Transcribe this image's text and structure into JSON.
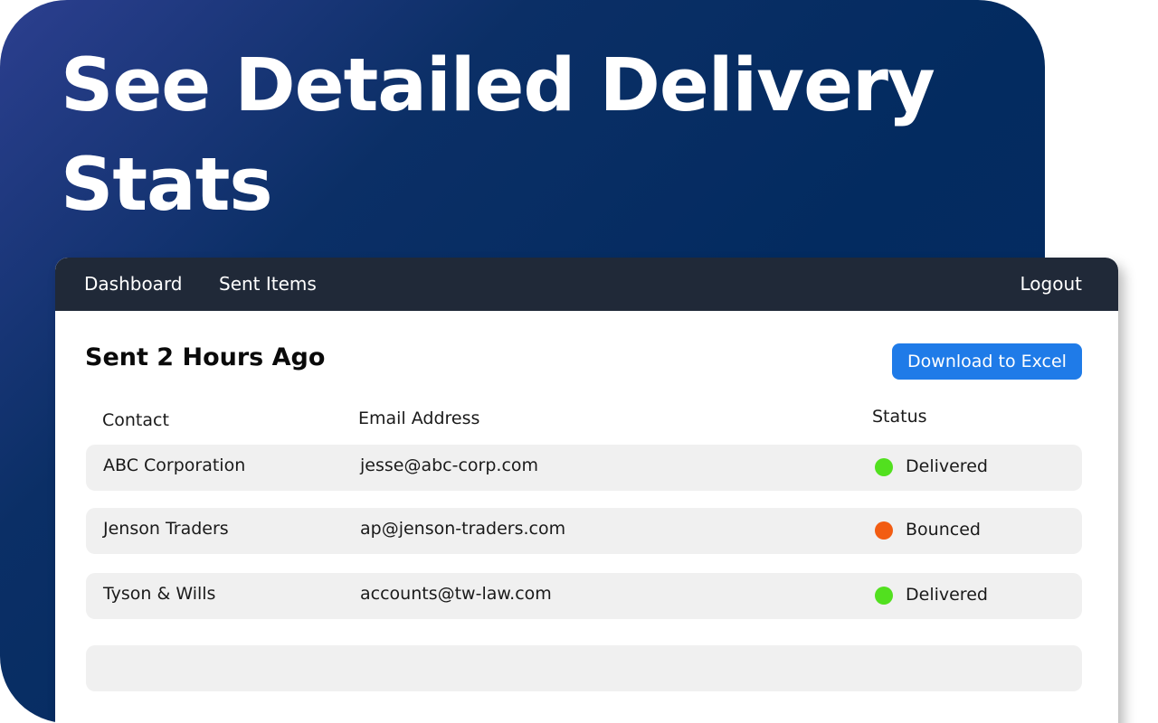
{
  "hero": {
    "title": "See Detailed Delivery Stats"
  },
  "nav": {
    "items": [
      {
        "label": "Dashboard"
      },
      {
        "label": "Sent Items"
      }
    ],
    "logout_label": "Logout"
  },
  "main": {
    "section_title": "Sent 2 Hours Ago",
    "download_label": "Download to Excel",
    "columns": {
      "contact": "Contact",
      "email": "Email Address",
      "status": "Status"
    },
    "rows": [
      {
        "contact": "ABC Corporation",
        "email": "jesse@abc-corp.com",
        "status": "Delivered",
        "status_color": "#52e01f"
      },
      {
        "contact": "Jenson Traders",
        "email": "ap@jenson-traders.com",
        "status": "Bounced",
        "status_color": "#f25c12"
      },
      {
        "contact": "Tyson & Wills",
        "email": "accounts@tw-law.com",
        "status": "Delivered",
        "status_color": "#52e01f"
      }
    ]
  },
  "colors": {
    "hero_bg": "#032b60",
    "navbar_bg": "#202938",
    "accent": "#1f7be8",
    "row_bg": "#f0f0f0",
    "delivered": "#52e01f",
    "bounced": "#f25c12"
  }
}
